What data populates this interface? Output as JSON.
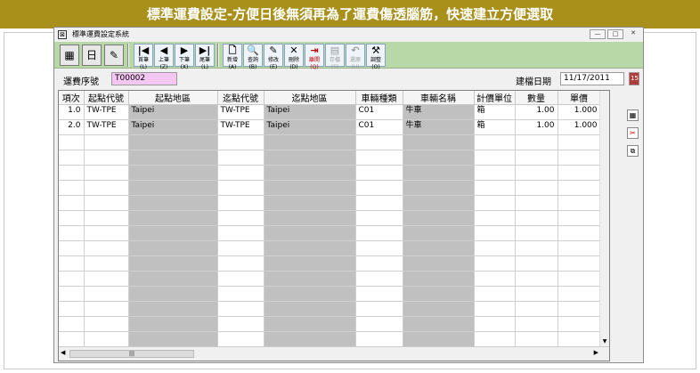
{
  "banner": "標準運費設定-方便日後無須再為了運費傷透腦筋，快速建立方便選取",
  "window": {
    "title": "標準運費設定系統",
    "minimize": "—",
    "maximize": "□",
    "close": "✕"
  },
  "toolbar": {
    "calc": "▦",
    "calendar": "日",
    "book": "✎",
    "nav": [
      {
        "glyph": "|◀",
        "label": "首筆(L)"
      },
      {
        "glyph": "◀",
        "label": "上筆(Z)"
      },
      {
        "glyph": "▶",
        "label": "下筆(X)"
      },
      {
        "glyph": "▶|",
        "label": "尾筆(L)"
      }
    ],
    "actions": [
      {
        "glyph": "🗋",
        "label": "新增(A)"
      },
      {
        "glyph": "🔍",
        "label": "查詢(B)"
      },
      {
        "glyph": "✎",
        "label": "修改(E)"
      },
      {
        "glyph": "✕",
        "label": "刪除(D)"
      },
      {
        "glyph": "⇥",
        "label": "離開(Q)"
      },
      {
        "glyph": "▤",
        "label": "存檔(S)"
      },
      {
        "glyph": "↶",
        "label": "還原(U)"
      },
      {
        "glyph": "⚒",
        "label": "調整(O)"
      }
    ]
  },
  "header": {
    "serial_label": "運費序號",
    "serial_value": "T00002",
    "date_label": "建檔日期",
    "date_value": "11/17/2011",
    "date_icon": "calendar-icon"
  },
  "grid": {
    "columns": [
      "項次",
      "起點代號",
      "起點地區",
      "迄點代號",
      "迄點地區",
      "車輛種類",
      "車輛名稱",
      "計價單位",
      "數量",
      "單價"
    ],
    "rows": [
      [
        "1.0",
        "TW-TPE",
        "Taipei",
        "TW-TPE",
        "Taipei",
        "C01",
        "牛車",
        "箱",
        "1.00",
        "1.000"
      ],
      [
        "2.0",
        "TW-TPE",
        "Taipei",
        "TW-TPE",
        "Taipei",
        "C01",
        "牛車",
        "箱",
        "1.00",
        "1.000"
      ]
    ],
    "empty_rows": 14
  },
  "side_icons": [
    "grid-icon",
    "cut-icon",
    "copy-icon"
  ],
  "colors": {
    "banner": "#a8901b",
    "toolbar": "#b8d8a8",
    "serial_field": "#f4c6f2",
    "grey_cell": "#c0c0c0"
  }
}
